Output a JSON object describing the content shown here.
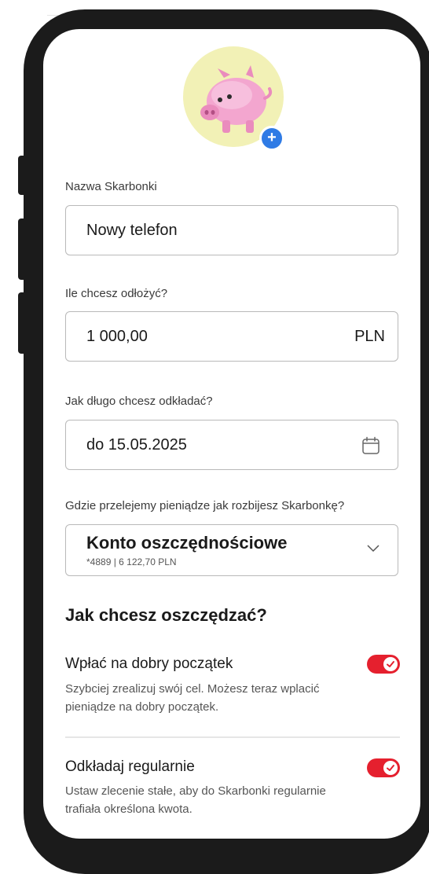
{
  "avatar": {
    "icon": "piggy-bank-icon",
    "add_icon": "plus-icon",
    "add_symbol": "+"
  },
  "name_field": {
    "label": "Nazwa Skarbonki",
    "value": "Nowy telefon"
  },
  "amount_field": {
    "label": "Ile chcesz odłożyć?",
    "value": "1 000,00",
    "currency": "PLN"
  },
  "date_field": {
    "label": "Jak długo chcesz odkładać?",
    "value": "do 15.05.2025",
    "icon": "calendar-icon"
  },
  "account_field": {
    "label": "Gdzie przelejemy pieniądze jak rozbijesz Skarbonkę?",
    "title": "Konto oszczędnościowe",
    "subtitle": "*4889 | 6 122,70 PLN",
    "icon": "chevron-down-icon"
  },
  "saving": {
    "title": "Jak chcesz oszczędzać?",
    "options": [
      {
        "title": "Wpłać na dobry początek",
        "desc": "Szybciej zrealizuj swój cel. Możesz teraz wplacić pieniądze na dobry początek.",
        "enabled": true
      },
      {
        "title": "Odkładaj regularnie",
        "desc": "Ustaw zlecenie stałe, aby do Skarbonki regularnie trafiała określona kwota.",
        "enabled": true
      }
    ]
  },
  "colors": {
    "accent": "#e5202e",
    "badge": "#2f7be5",
    "avatar_bg": "#f2f1b6",
    "frame": "#1b1b1b"
  }
}
